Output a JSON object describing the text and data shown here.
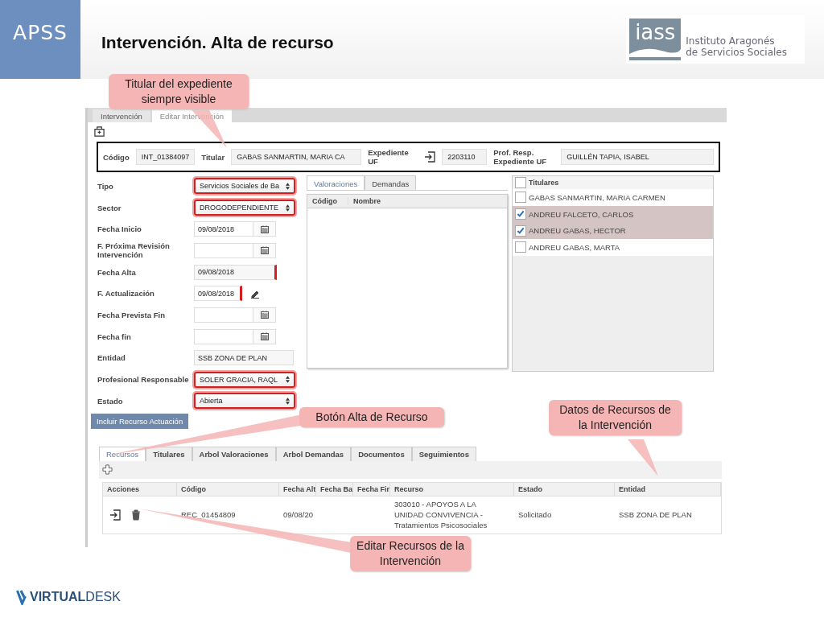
{
  "slide": {
    "badge": "APSS",
    "title": "Intervención. Alta de recurso",
    "logo": {
      "mark": "iass",
      "lines": [
        "Instituto Aragonés",
        "de Servicios Sociales"
      ]
    },
    "footer_brand": "**VIRTUAL**DESK"
  },
  "app": {
    "top_tabs": [
      {
        "label": "Intervención",
        "selected": false
      },
      {
        "label": "Editar Intervención",
        "selected": true
      }
    ],
    "header_fields": [
      {
        "label": "Código",
        "value": "INT_01384097",
        "kind": "text"
      },
      {
        "label": "Titular",
        "value": "GABAS SANMARTIN, MARIA CA",
        "kind": "text"
      },
      {
        "label": "Expediente UF",
        "value": "2203110",
        "kind": "linked"
      },
      {
        "label": "Prof. Resp. Expediente UF",
        "value": "GUILLÉN TAPIA, ISABEL",
        "kind": "text"
      }
    ],
    "form_fields": [
      {
        "label": "Tipo",
        "value": "Servicios Sociales de Ba",
        "kind": "select",
        "required": true
      },
      {
        "label": "Sector",
        "value": "DROGODEPENDIENTE",
        "kind": "select",
        "required": true
      },
      {
        "label": "Fecha Inicio",
        "value": "09/08/2018",
        "kind": "date",
        "required": false
      },
      {
        "label": "F. Próxima Revisión Intervención",
        "kind": "date",
        "required": false
      },
      {
        "label": "Fecha Alta",
        "value": "09/08/2018",
        "kind": "text",
        "required": true
      },
      {
        "label": "F. Actualización",
        "value": "09/08/2018",
        "kind": "edit",
        "required": true
      },
      {
        "label": "Fecha Prevista Fin",
        "kind": "date",
        "required": false
      },
      {
        "label": "Fecha fin",
        "kind": "date",
        "required": false
      },
      {
        "label": "Entidad",
        "value": "SSB ZONA DE PLAN",
        "kind": "readonly",
        "required": false
      },
      {
        "label": "Profesional Responsable",
        "value": "SOLER GRACIA, RAQL",
        "kind": "select",
        "required": true
      },
      {
        "label": "Estado",
        "value": "Abierta",
        "kind": "select",
        "required": true
      }
    ],
    "middle_panel": {
      "tabs": [
        {
          "label": "Valoraciones",
          "selected": true
        },
        {
          "label": "Demandas",
          "selected": false
        }
      ],
      "columns": [
        "Código",
        "Nombre"
      ]
    },
    "titulares": {
      "header": "Titulares",
      "header_checked": false,
      "items": [
        {
          "name": "GABAS SANMARTIN, MARIA CARMEN",
          "checked": false
        },
        {
          "name": "ANDREU FALCETO, CARLOS",
          "checked": true
        },
        {
          "name": "ANDREU GABAS, HECTOR",
          "checked": true
        },
        {
          "name": "ANDREU GABAS, MARTA",
          "checked": false
        }
      ]
    },
    "include_button": "Incluir Recurso Actuación",
    "bottom_tabs": [
      {
        "label": "Recursos",
        "selected": true
      },
      {
        "label": "Titulares",
        "selected": false
      },
      {
        "label": "Arbol Valoraciones",
        "selected": false
      },
      {
        "label": "Arbol Demandas",
        "selected": false
      },
      {
        "label": "Documentos",
        "selected": false
      },
      {
        "label": "Seguimientos",
        "selected": false
      }
    ],
    "table": {
      "columns": [
        "Acciones",
        "Código",
        "Fecha Alt",
        "Fecha Ba",
        "Fecha Fir",
        "Recurso",
        "Estado",
        "Entidad"
      ],
      "rows": [
        {
          "codigo": "REC_01454809",
          "fecha_alta": "09/08/20",
          "recurso": "303010 - APOYOS A LA UNIDAD CONVIVENCIA - Tratamientos Psicosociales",
          "estado": "Solicitado",
          "entidad": "SSB ZONA DE PLAN"
        }
      ]
    }
  },
  "callouts": [
    {
      "text": "Titular del expediente siempre visible"
    },
    {
      "text": "Botón Alta de Recurso"
    },
    {
      "text": "Datos de Recursos de la Intervención"
    },
    {
      "text": "Editar Recursos de la Intervención"
    }
  ]
}
